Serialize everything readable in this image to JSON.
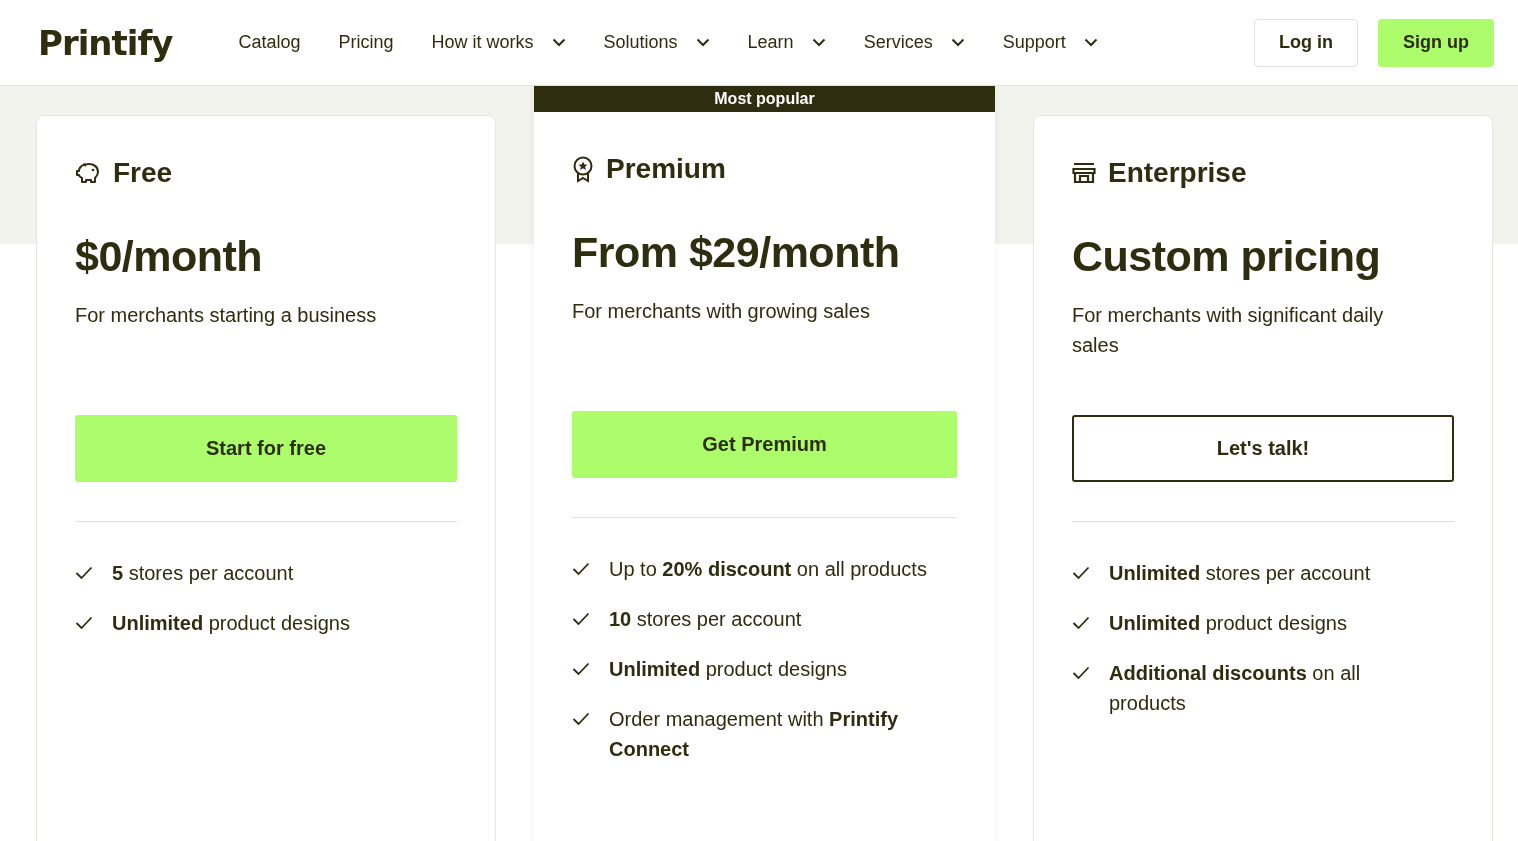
{
  "header": {
    "logo": "Printify",
    "nav": [
      {
        "label": "Catalog",
        "dropdown": false
      },
      {
        "label": "Pricing",
        "dropdown": false
      },
      {
        "label": "How it works",
        "dropdown": true
      },
      {
        "label": "Solutions",
        "dropdown": true
      },
      {
        "label": "Learn",
        "dropdown": true
      },
      {
        "label": "Services",
        "dropdown": true
      },
      {
        "label": "Support",
        "dropdown": true
      }
    ],
    "login": "Log in",
    "signup": "Sign up"
  },
  "plans": [
    {
      "name": "Free",
      "highlighted": false,
      "price": "$0/month",
      "description": "For merchants starting a business",
      "button": {
        "label": "Start for free",
        "kind": "filled"
      },
      "features": [
        "**5** stores per account",
        "**Unlimited** product designs"
      ]
    },
    {
      "name": "Premium",
      "highlighted": true,
      "banner": "Most popular",
      "price": "From $29/month",
      "description": "For merchants with growing sales",
      "button": {
        "label": "Get Premium",
        "kind": "filled"
      },
      "features": [
        "Up to **20% discount** on all products",
        "**10** stores per account",
        "**Unlimited** product designs",
        "Order management with **Printify Connect**"
      ]
    },
    {
      "name": "Enterprise",
      "highlighted": false,
      "price": "Custom pricing",
      "description": "For merchants with significant daily sales",
      "button": {
        "label": "Let's talk!",
        "kind": "outline"
      },
      "features": [
        "**Unlimited** stores per account",
        "**Unlimited** product designs",
        "**Additional discounts** on all products"
      ]
    }
  ]
}
